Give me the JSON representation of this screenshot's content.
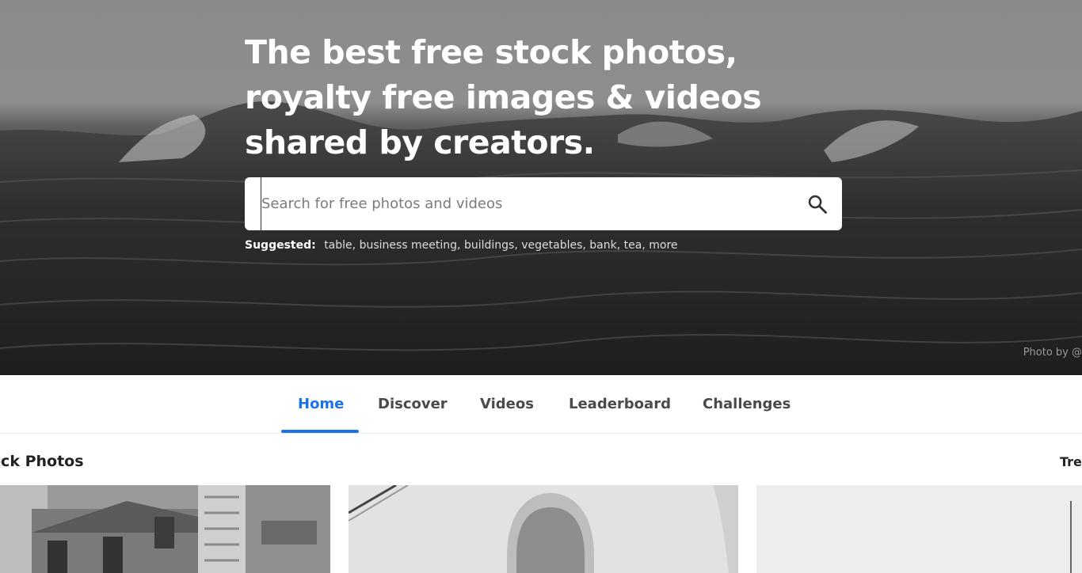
{
  "hero": {
    "title": "The best free stock photos, royalty free images & videos shared by creators.",
    "search": {
      "placeholder": "Search for free photos and videos"
    },
    "suggested_label": "Suggested:",
    "suggested_tags": [
      "table",
      "business meeting",
      "buildings",
      "vegetables",
      "bank",
      "tea",
      "more"
    ],
    "photo_credit": "Photo by @"
  },
  "nav": {
    "items": [
      {
        "label": "Home",
        "active": true
      },
      {
        "label": "Discover",
        "active": false
      },
      {
        "label": "Videos",
        "active": false
      },
      {
        "label": "Leaderboard",
        "active": false
      },
      {
        "label": "Challenges",
        "active": false
      }
    ]
  },
  "section": {
    "title": "ock Photos",
    "trending_label": "Tren"
  },
  "colors": {
    "accent": "#1a73e8",
    "nav_text": "#4a4a4a"
  }
}
